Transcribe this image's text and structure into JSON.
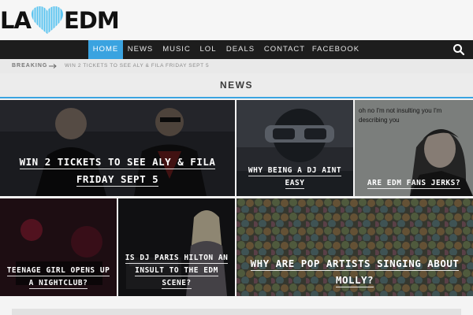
{
  "logo": {
    "left": "LA",
    "right": "EDM"
  },
  "nav": {
    "items": [
      {
        "label": "HOME",
        "active": true
      },
      {
        "label": "NEWS",
        "active": false
      },
      {
        "label": "MUSIC",
        "active": false
      },
      {
        "label": "LOL",
        "active": false
      },
      {
        "label": "DEALS",
        "active": false
      },
      {
        "label": "CONTACT",
        "active": false
      },
      {
        "label": "FACEBOOK",
        "active": false
      }
    ],
    "search_icon": "search-icon"
  },
  "breaking": {
    "label": "BREAKING",
    "headline": "WIN 2 TICKETS TO SEE ALY & FILA FRIDAY SEPT 5"
  },
  "section": {
    "title": "NEWS"
  },
  "meme_text": "oh no I'm not insulting you I'm describing you",
  "articles": [
    {
      "title": "WIN 2 TICKETS TO SEE ALY & FILA FRIDAY SEPT 5"
    },
    {
      "title": "WHY BEING A DJ AINT EASY"
    },
    {
      "title": "ARE EDM FANS JERKS?"
    },
    {
      "title": "TEENAGE GIRL OPENS UP A NIGHTCLUB?"
    },
    {
      "title": "IS DJ PARIS HILTON AN INSULT TO THE EDM SCENE?"
    },
    {
      "title": "WHY ARE POP ARTISTS SINGING ABOUT MOLLY?"
    }
  ],
  "colors": {
    "accent": "#3aa3e0",
    "nav_bg": "#1d1d1d",
    "heart": "#5bc4f0"
  }
}
